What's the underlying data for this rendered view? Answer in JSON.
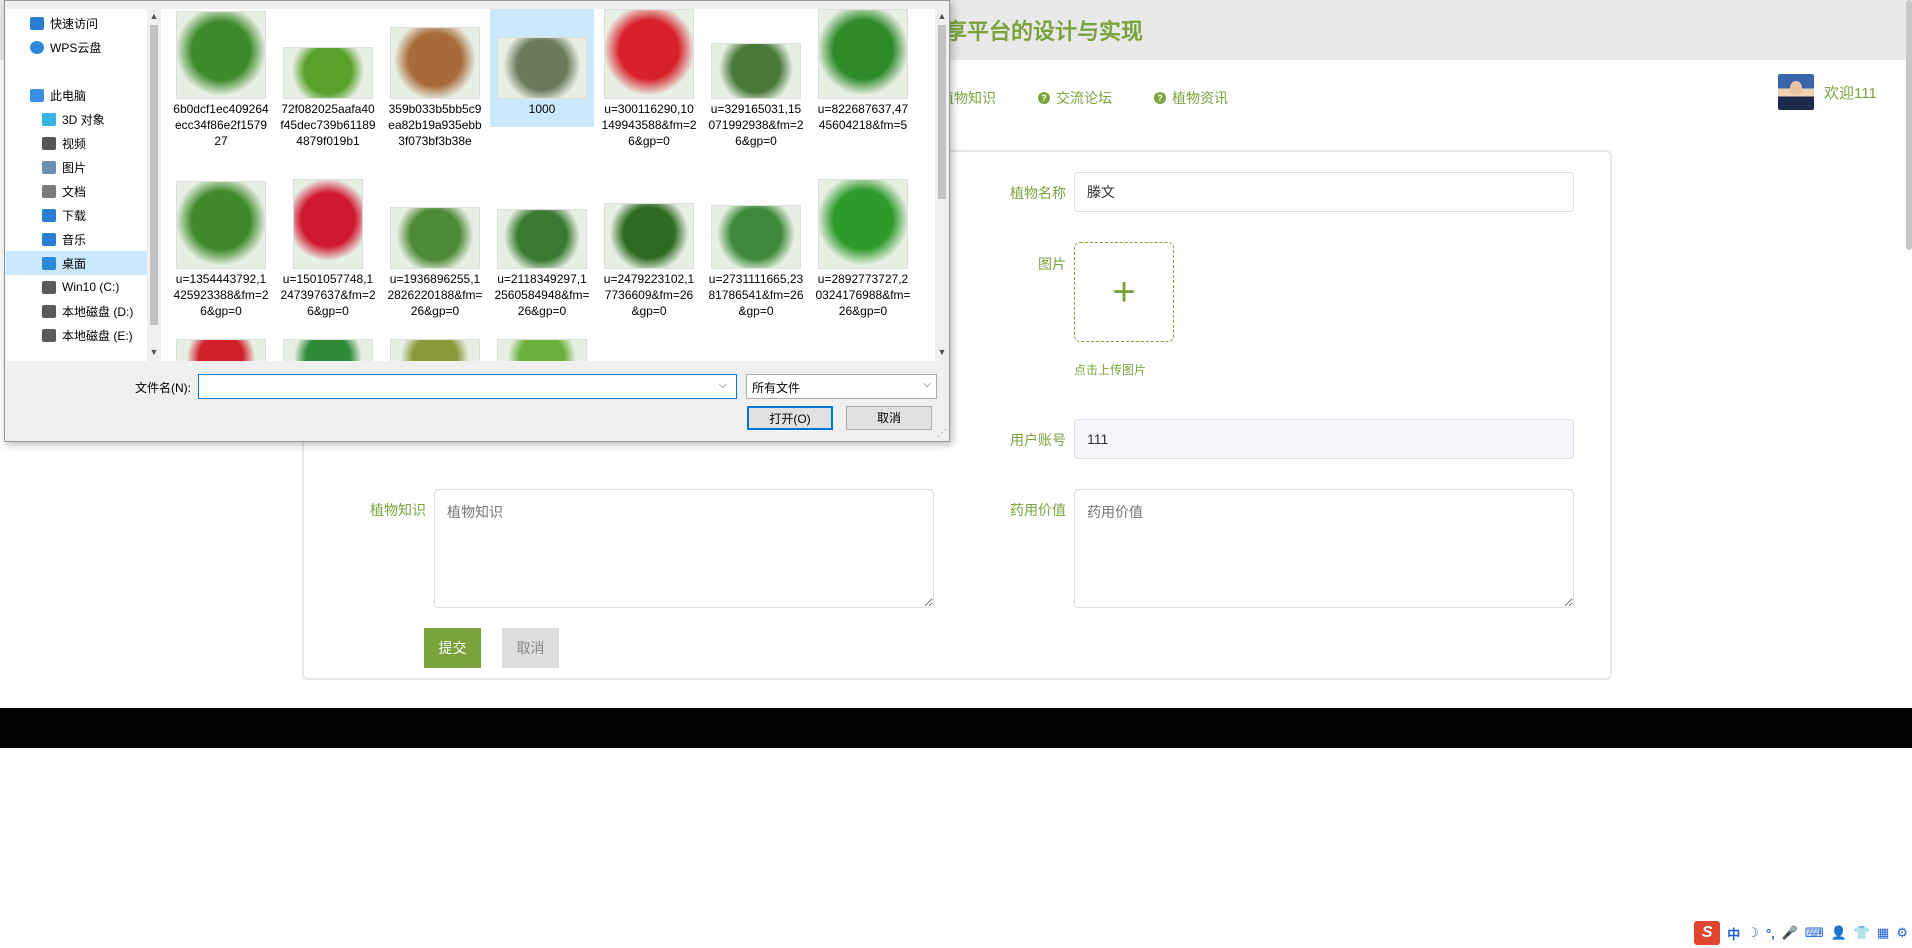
{
  "site": {
    "title": "享平台的设计与实现",
    "welcome": "欢迎111"
  },
  "nav": [
    {
      "label": "植物知识",
      "icon": ""
    },
    {
      "label": "交流论坛",
      "icon": "?"
    },
    {
      "label": "植物资讯",
      "icon": "?"
    }
  ],
  "form": {
    "name_label": "植物名称",
    "name_value": "滕文",
    "image_label": "图片",
    "upload_hint": "点击上传图片",
    "account_label": "用户账号",
    "account_value": "111",
    "knowledge_label": "植物知识",
    "knowledge_placeholder": "植物知识",
    "medicinal_label": "药用价值",
    "medicinal_placeholder": "药用价值",
    "submit_label": "提交",
    "cancel_label": "取消"
  },
  "dialog": {
    "sidebar": [
      {
        "label": "快速访问",
        "icon": "star-icon",
        "color": "#2b7cd3"
      },
      {
        "label": "WPS云盘",
        "icon": "cloud-icon",
        "color": "#2b88d8"
      },
      {
        "label": "此电脑",
        "icon": "computer-icon",
        "color": "#3a8ee6"
      },
      {
        "label": "3D 对象",
        "icon": "cube-icon",
        "color": "#34b4e4"
      },
      {
        "label": "视频",
        "icon": "video-icon",
        "color": "#555555"
      },
      {
        "label": "图片",
        "icon": "picture-icon",
        "color": "#6d8fb3"
      },
      {
        "label": "文档",
        "icon": "document-icon",
        "color": "#7a7a7a"
      },
      {
        "label": "下载",
        "icon": "download-icon",
        "color": "#2b7cd3"
      },
      {
        "label": "音乐",
        "icon": "music-icon",
        "color": "#2b7cd3"
      },
      {
        "label": "桌面",
        "icon": "desktop-icon",
        "color": "#2b88d8"
      },
      {
        "label": "Win10 (C:)",
        "icon": "drive-icon",
        "color": "#5a5a5a"
      },
      {
        "label": "本地磁盘 (D:)",
        "icon": "drive-icon",
        "color": "#5a5a5a"
      },
      {
        "label": "本地磁盘 (E:)",
        "icon": "drive-icon",
        "color": "#5a5a5a"
      }
    ],
    "selected_sidebar": "桌面",
    "files": [
      {
        "name": "6b0dcf1ec409264ecc34f86e2f157927",
        "color": "#3d8a2a"
      },
      {
        "name": "72f082025aafa40f45dec739b611894879f019b1",
        "color": "#5aa02c"
      },
      {
        "name": "359b033b5bb5c9ea82b19a935ebb3f073bf3b38e",
        "color": "#a86a3a"
      },
      {
        "name": "1000",
        "color": "#6a7a5a",
        "selected": true
      },
      {
        "name": "u=300116290,10149943588&fm=26&gp=0",
        "color": "#d8202a"
      },
      {
        "name": "u=329165031,15071992938&fm=26&gp=0",
        "color": "#4a7a3a"
      },
      {
        "name": "u=822687637,4745604218&fm=5",
        "color": "#2f8a2a"
      },
      {
        "name": "u=1354443792,1425923388&fm=26&gp=0",
        "color": "#3e8a2a"
      },
      {
        "name": "u=1501057748,1247397637&fm=26&gp=0",
        "color": "#d01830"
      },
      {
        "name": "u=1936896255,12826220188&fm=26&gp=0",
        "color": "#4e8a36"
      },
      {
        "name": "u=2118349297,12560584948&fm=26&gp=0",
        "color": "#3a7a32"
      },
      {
        "name": "u=2479223102,17736609&fm=26&gp=0",
        "color": "#2f6a22"
      },
      {
        "name": "u=2731111665,2381786541&fm=26&gp=0",
        "color": "#3e8a3a"
      },
      {
        "name": "u=2892773727,20324176988&fm=26&gp=0",
        "color": "#2e9a2a"
      },
      {
        "name": "",
        "color": "#d0202a"
      },
      {
        "name": "",
        "color": "#2e8a3a"
      },
      {
        "name": "",
        "color": "#8a9a3a"
      },
      {
        "name": "",
        "color": "#6ab03a"
      }
    ],
    "filename_label": "文件名(N):",
    "filename_value": "",
    "filetype": "所有文件",
    "open_label": "打开(O)",
    "cancel_label": "取消"
  },
  "tray": {
    "ime_logo": "S",
    "ime_mode": "中",
    "items": [
      "☽",
      "°,",
      "🎤",
      "⌨",
      "👤",
      "👕",
      "▦",
      "⚙"
    ]
  }
}
